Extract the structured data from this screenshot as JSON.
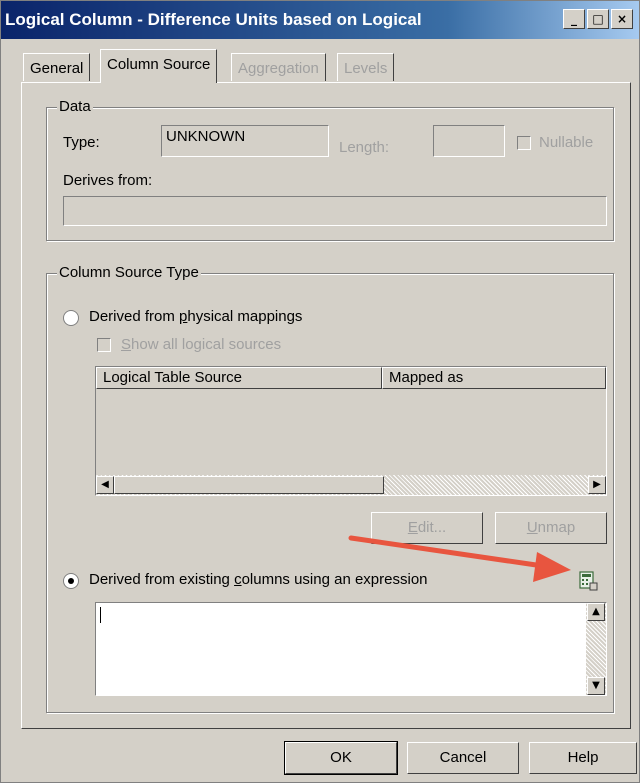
{
  "window": {
    "title": "Logical Column - Difference Units based on Logical",
    "buttons": {
      "minimize": "_",
      "maximize": "□",
      "close": "×"
    }
  },
  "tabs": [
    {
      "label": "General",
      "state": "normal"
    },
    {
      "label": "Column Source",
      "state": "active"
    },
    {
      "label": "Aggregation",
      "state": "disabled"
    },
    {
      "label": "Levels",
      "state": "disabled"
    }
  ],
  "data_group": {
    "legend": "Data",
    "type_label": "Type:",
    "type_value": "UNKNOWN",
    "length_label": "Length:",
    "length_value": "",
    "nullable_label": "Nullable",
    "derives_from_label": "Derives from:",
    "derives_from_value": ""
  },
  "source_group": {
    "legend": "Column Source Type",
    "option_physical": {
      "pre": "Derived from ",
      "accel": "p",
      "post": "hysical mappings",
      "selected": false
    },
    "show_all": {
      "pre": "",
      "accel": "S",
      "post": "how all logical sources",
      "checked": false
    },
    "table_headers": [
      "Logical Table Source",
      "Mapped as"
    ],
    "table_rows": [],
    "edit_button": {
      "pre": "",
      "accel": "E",
      "post": "dit..."
    },
    "unmap_button": {
      "pre": "",
      "accel": "U",
      "post": "nmap"
    },
    "option_expression": {
      "pre": "Derived from existing ",
      "accel": "c",
      "post": "olumns using an expression",
      "selected": true
    },
    "expression_value": "",
    "builder_icon": "expression-builder-icon"
  },
  "footer": {
    "ok": "OK",
    "cancel": "Cancel",
    "help": "Help"
  },
  "colors": {
    "title_start": "#0a246a",
    "arrow": "#e8553f",
    "dialog_bg": "#d4d0c8"
  }
}
